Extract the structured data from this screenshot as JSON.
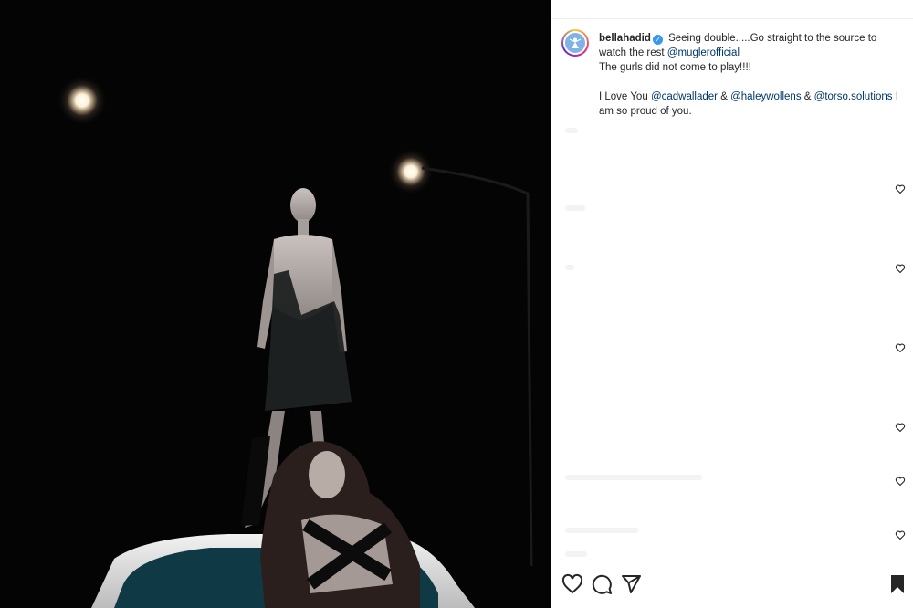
{
  "post": {
    "username": "bellahadid",
    "caption_line1": "Seeing double.....Go straight to the source to watch the rest",
    "mention_source": "@muglerofficial",
    "caption_line2": "The gurls did not come to play!!!!",
    "thanks_prefix": "I Love You",
    "mention_1": "@cadwallader",
    "amp_1": "&",
    "mention_2": "@haleywollens",
    "amp_2": "&",
    "mention_3": "@torso.solutions",
    "thanks_suffix": "I am so proud of you."
  },
  "colors": {
    "mention": "#00376b",
    "verified": "#3897f0",
    "text": "#262626"
  },
  "icons": {
    "like": "heart-icon",
    "comment": "comment-icon",
    "share": "send-icon",
    "save": "bookmark-icon",
    "comment_like": "small-heart-icon"
  }
}
